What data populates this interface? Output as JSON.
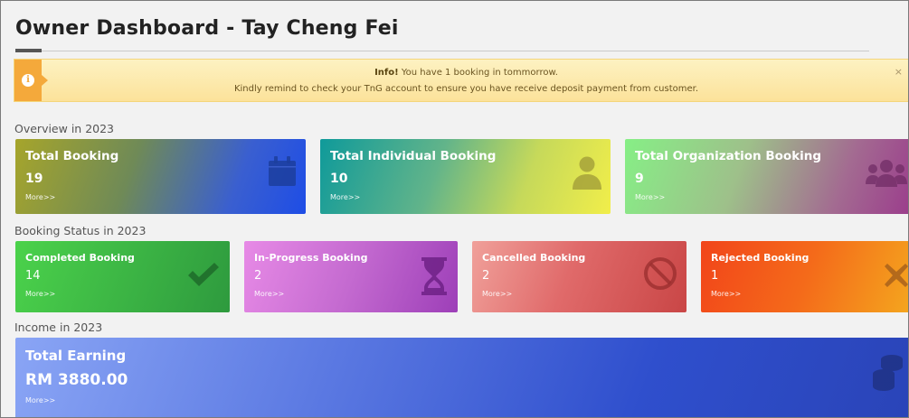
{
  "header": {
    "title": "Owner Dashboard - Tay Cheng Fei"
  },
  "alert": {
    "icon": "info-icon",
    "strong": "Info!",
    "line1": "You have 1 booking in tommorrow.",
    "line2": "Kindly remind to check your TnG account to ensure you have receive deposit payment from customer.",
    "close": "×"
  },
  "overview": {
    "label": "Overview in 2023",
    "cards": [
      {
        "title": "Total Booking",
        "value": "19",
        "more": "More>>",
        "icon": "calendar-icon"
      },
      {
        "title": "Total Individual Booking",
        "value": "10",
        "more": "More>>",
        "icon": "user-icon"
      },
      {
        "title": "Total Organization Booking",
        "value": "9",
        "more": "More>>",
        "icon": "users-icon"
      }
    ]
  },
  "status": {
    "label": "Booking Status in 2023",
    "cards": [
      {
        "title": "Completed Booking",
        "value": "14",
        "more": "More>>",
        "icon": "check-icon"
      },
      {
        "title": "In-Progress Booking",
        "value": "2",
        "more": "More>>",
        "icon": "hourglass-icon"
      },
      {
        "title": "Cancelled Booking",
        "value": "2",
        "more": "More>>",
        "icon": "ban-icon"
      },
      {
        "title": "Rejected Booking",
        "value": "1",
        "more": "More>>",
        "icon": "times-icon"
      }
    ]
  },
  "income": {
    "label": "Income in 2023",
    "card": {
      "title": "Total Earning",
      "value": "RM 3880.00",
      "more": "More>>",
      "icon": "coins-icon"
    }
  }
}
